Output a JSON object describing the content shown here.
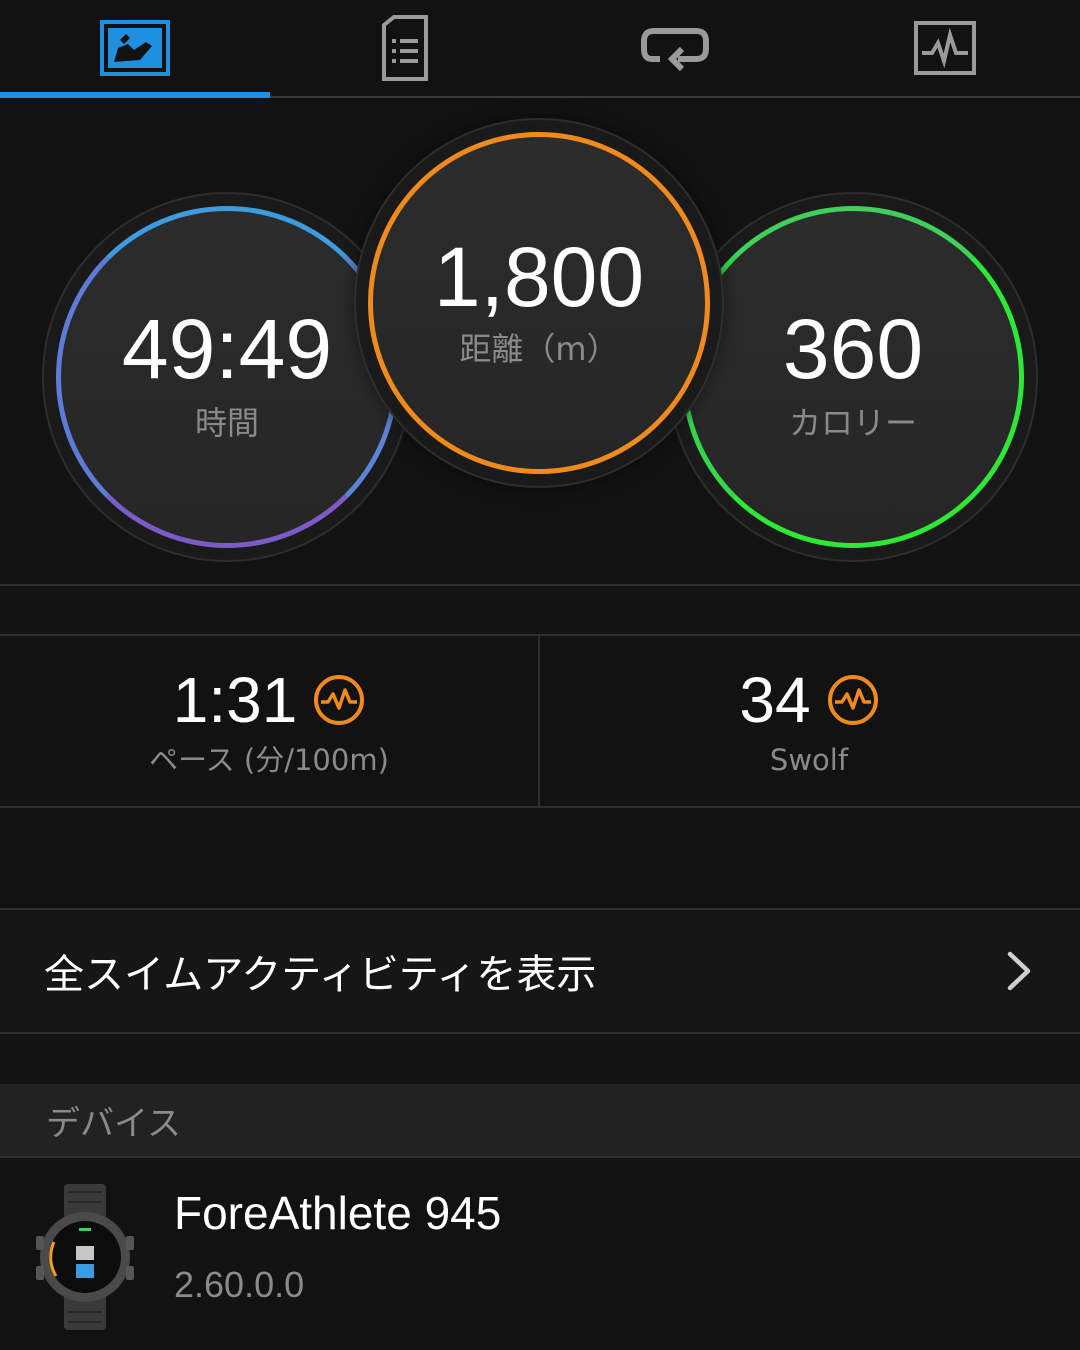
{
  "tabs": [
    {
      "name": "summary",
      "icon": "activity-summary-icon",
      "active": true
    },
    {
      "name": "details",
      "icon": "document-list-icon",
      "active": false
    },
    {
      "name": "laps",
      "icon": "repeat-loop-icon",
      "active": false
    },
    {
      "name": "charts",
      "icon": "line-chart-icon",
      "active": false
    }
  ],
  "summary": {
    "time": {
      "value": "49:49",
      "label": "時間",
      "color": "#3d9be0"
    },
    "distance": {
      "value": "1,800",
      "label": "距離（m）",
      "color": "#f08a1c"
    },
    "calories": {
      "value": "360",
      "label": "カロリー",
      "color": "#2ee836"
    }
  },
  "stats": {
    "pace": {
      "value": "1:31",
      "label": "ペース (分/100m)",
      "icon": "chart-badge-icon"
    },
    "swolf": {
      "value": "34",
      "label": "Swolf",
      "icon": "chart-badge-icon"
    }
  },
  "link": {
    "label": "全スイムアクティビティを表示",
    "icon": "chevron-right-icon"
  },
  "device": {
    "header": "デバイス",
    "name": "ForeAthlete 945",
    "version": "2.60.0.0",
    "icon": "watch-icon"
  },
  "colors": {
    "accent": "#1f8fe0",
    "badge": "#f08a1c",
    "background": "#121212"
  }
}
